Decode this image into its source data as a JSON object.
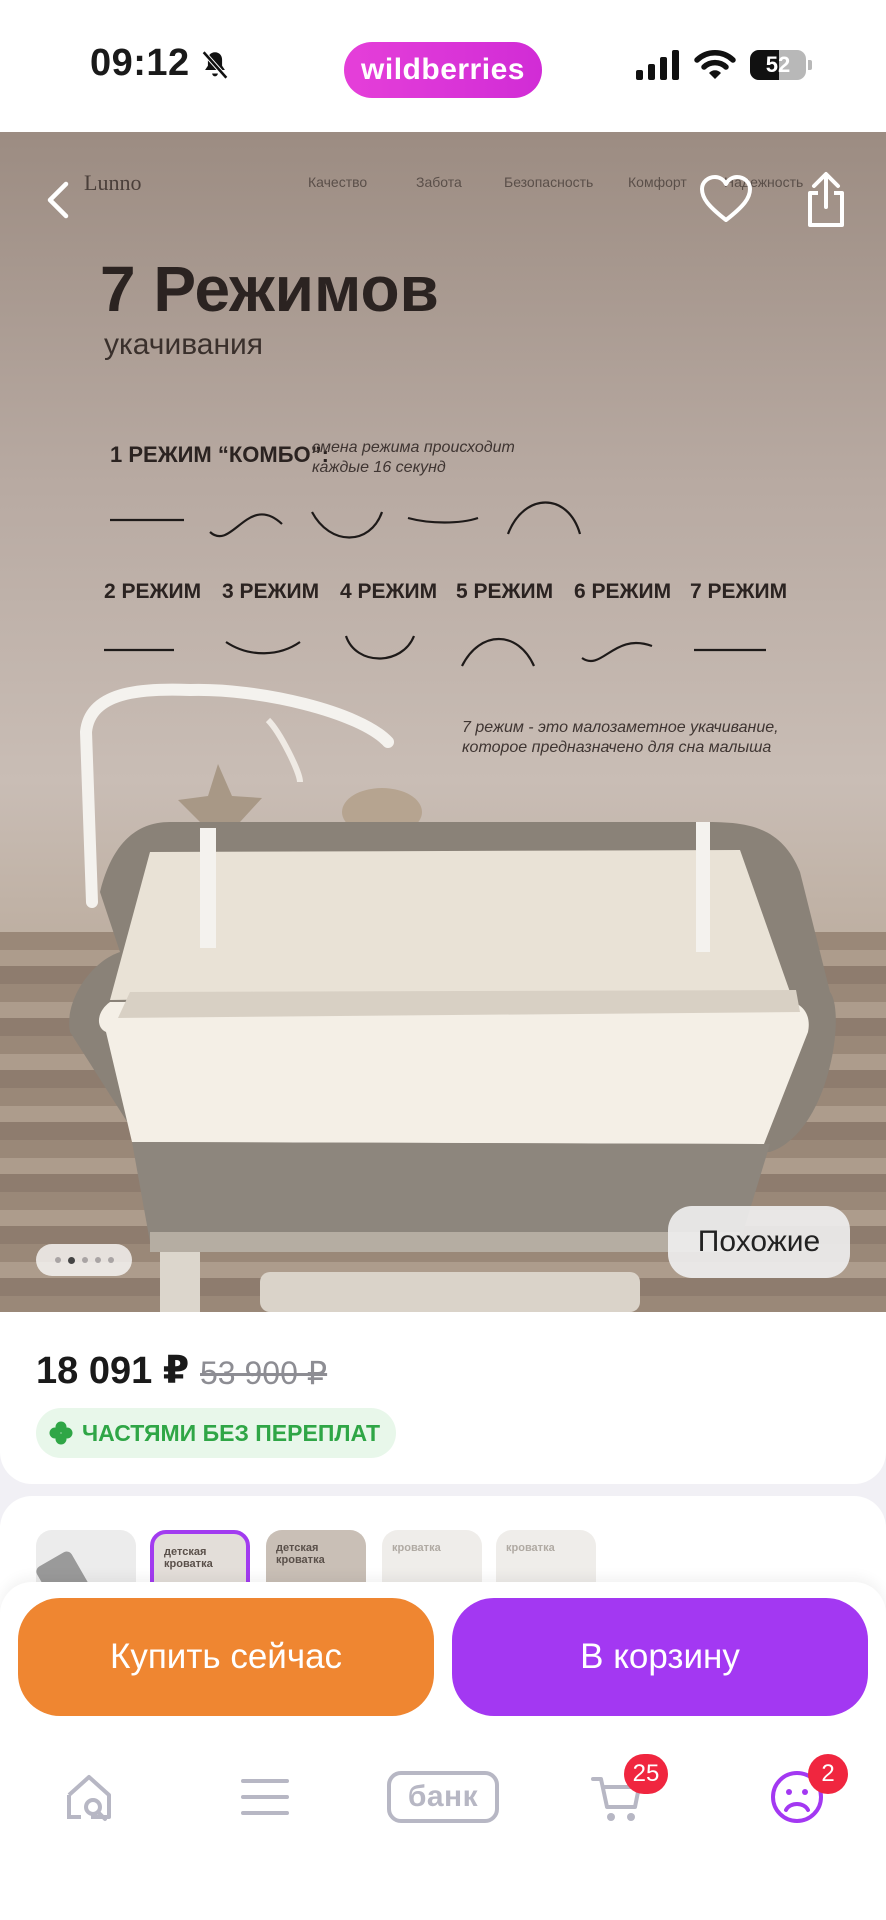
{
  "status_bar": {
    "time": "09:12",
    "brand": "wildberries",
    "battery_level": "52",
    "battery_fraction": 0.52
  },
  "product_image": {
    "brand": "Lunno",
    "tabs": [
      "Качество",
      "Забота",
      "Безопасность",
      "Комфорт",
      "Надежность"
    ],
    "title": "7 Режимов",
    "subtitle": "укачивания",
    "combo_label": "1 РЕЖИМ “КОМБО”:",
    "combo_note": "смена режима происходит каждые 16 секунд",
    "modes": [
      "2 РЕЖИМ",
      "3 РЕЖИМ",
      "4 РЕЖИМ",
      "5 РЕЖИМ",
      "6 РЕЖИМ",
      "7 РЕЖИМ"
    ],
    "mode7_note": "7 режим - это малозаметное укачивание, которое предназначено для сна малыша",
    "similar_button": "Похожие",
    "carousel_total": 5,
    "carousel_active": 2
  },
  "price": {
    "current": "18 091 ₽",
    "old": "53 900 ₽",
    "installment": "ЧАСТЯМИ БЕЗ ПЕРЕПЛАТ"
  },
  "thumbnails": [
    {
      "label": ""
    },
    {
      "label": "детская кроватка"
    },
    {
      "label": "детская кроватка"
    },
    {
      "label": "кроватка"
    },
    {
      "label": "кроватка"
    }
  ],
  "actions": {
    "buy_now": "Купить сейчас",
    "add_to_cart": "В корзину"
  },
  "tabbar": {
    "bank_label": "банк",
    "cart_badge": "25",
    "profile_badge": "2"
  },
  "colors": {
    "brand": "#d12cd6",
    "buy_button": "#ef8631",
    "cart_button": "#a338f2",
    "badge": "#f0263f",
    "installment_green": "#2fa646"
  }
}
